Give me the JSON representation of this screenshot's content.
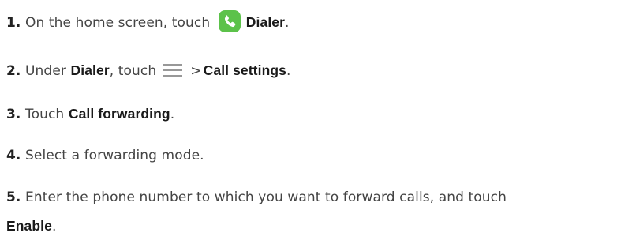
{
  "steps": [
    {
      "number": "1.",
      "text_before": "On the home screen, touch",
      "icon": "dialer-phone-icon",
      "bold": "Dialer",
      "text_after": "."
    },
    {
      "number": "2.",
      "text_before": "Under",
      "bold_a": "Dialer",
      "text_mid": ", touch",
      "icon": "menu-icon",
      "gt": ">",
      "bold_b": "Call settings",
      "text_after": "."
    },
    {
      "number": "3.",
      "text_before": "Touch",
      "bold": "Call forwarding",
      "text_after": "."
    },
    {
      "number": "4.",
      "text": "Select a forwarding mode."
    },
    {
      "number": "5.",
      "text_line1": "Enter the phone number to which you want to forward calls, and touch",
      "bold": "Enable",
      "text_after": "."
    }
  ],
  "colors": {
    "dialer_icon_bg": "#5cc24a",
    "dialer_icon_glyph": "#ffffff",
    "text": "#444444"
  }
}
